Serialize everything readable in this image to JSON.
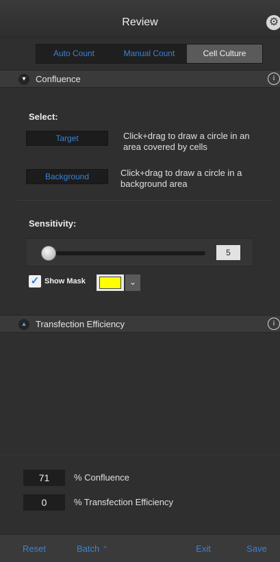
{
  "header": {
    "title": "Review",
    "settings_icon": "gear-icon"
  },
  "tabs": [
    {
      "label": "Auto Count",
      "active": false
    },
    {
      "label": "Manual Count",
      "active": false
    },
    {
      "label": "Cell Culture",
      "active": true
    }
  ],
  "confluence": {
    "title": "Confluence",
    "select_label": "Select:",
    "target_button": "Target",
    "target_hint": "Click+drag to draw a circle in an area covered by cells",
    "background_button": "Background",
    "background_hint": "Click+drag to draw a circle in a background area",
    "sensitivity_label": "Sensitivity:",
    "sensitivity_value": "5",
    "show_mask_checked": true,
    "show_mask_label": "Show Mask",
    "mask_color": "#ffff00"
  },
  "transfection": {
    "title": "Transfection Efficiency"
  },
  "results": [
    {
      "value": "71",
      "label": "% Confluence"
    },
    {
      "value": "0",
      "label": "% Transfection Efficiency"
    }
  ],
  "footer": {
    "reset": "Reset",
    "batch": "Batch",
    "exit": "Exit",
    "save": "Save"
  },
  "colors": {
    "accent": "#3b82d6",
    "panel": "#2f2f2f",
    "header": "#3a3a3a"
  }
}
